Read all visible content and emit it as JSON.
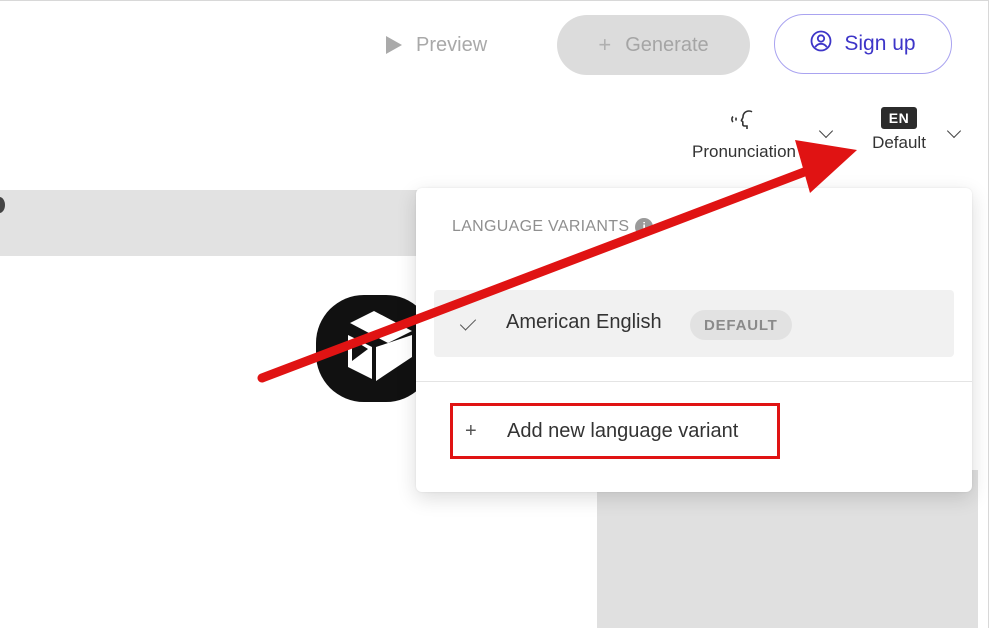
{
  "toolbar": {
    "preview_label": "Preview",
    "generate_label": "Generate",
    "signup_label": "Sign up"
  },
  "voice_controls": {
    "pronunciation_label": "Pronunciation",
    "language_code": "EN",
    "language_label": "Default"
  },
  "language_panel": {
    "section_title": "LANGUAGE VARIANTS",
    "info_glyph": "i",
    "variants": [
      {
        "name": "American English",
        "tag": "DEFAULT",
        "selected": true
      }
    ],
    "add_label": "Add new language variant"
  },
  "icons": {
    "preview": "play-icon",
    "generate": "plus-icon",
    "signup": "user-circle-icon",
    "pronunciation": "speaking-head-icon",
    "selected": "checkmark-icon",
    "add": "plus-icon"
  },
  "colors": {
    "accent": "#3d35c8",
    "annotation": "#e01313",
    "disabled": "#dcdcdc"
  }
}
